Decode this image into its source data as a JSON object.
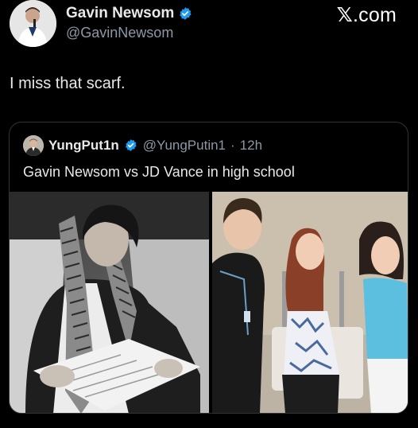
{
  "author": {
    "display_name": "Gavin Newsom",
    "handle": "@GavinNewsom",
    "verified_icon": "verified-badge-icon"
  },
  "brand": {
    "label": ".com",
    "mark": "𝕏"
  },
  "tweet": {
    "text": "I miss that scarf."
  },
  "quote": {
    "display_name": "YungPut1n",
    "handle": "@YungPutin1",
    "separator": "·",
    "time": "12h",
    "text": "Gavin Newsom vs JD Vance in high school"
  },
  "colors": {
    "background": "#000000",
    "text_primary": "#e7e9ea",
    "text_secondary": "#8b98a5",
    "verified_blue": "#1d9bf0",
    "border": "#2f3336"
  }
}
